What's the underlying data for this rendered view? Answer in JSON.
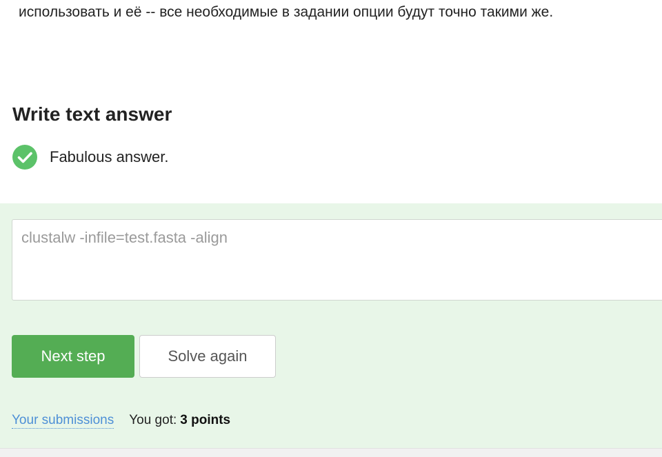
{
  "intro": {
    "text": "использовать и её -- все необходимые в задании опции будут точно такими же."
  },
  "quiz": {
    "title": "Write text answer",
    "feedback": "Fabulous answer.",
    "answer_value": "clustalw -infile=test.fasta -align",
    "buttons": {
      "next_label": "Next step",
      "solve_again_label": "Solve again"
    },
    "footer": {
      "submissions_label": "Your submissions",
      "score_prefix": "You got:",
      "score_points": "3 points"
    }
  },
  "colors": {
    "success_green": "#54ad54",
    "check_icon_green": "#5cc269",
    "panel_background": "#e8f6e8",
    "link_blue": "#4d8fd6"
  },
  "icons": {
    "feedback_icon": "check-circle-icon"
  }
}
